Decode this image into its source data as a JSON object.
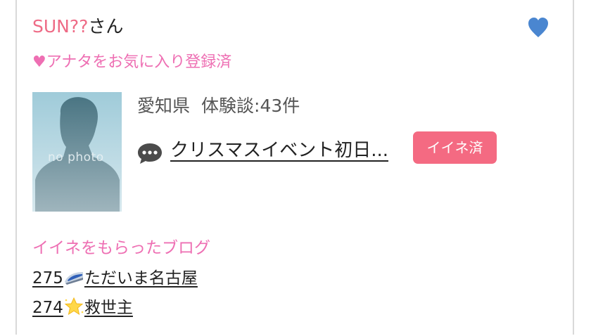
{
  "profile": {
    "name": "SUN??",
    "honorific": "さん",
    "favorite_status": "♥アナタをお気に入り登録済",
    "favorite_icon": "heart-icon",
    "favorite_color": "#4a86d0",
    "avatar_placeholder": "no photo",
    "prefecture": "愛知県",
    "experience_label": "体験談:43件"
  },
  "post": {
    "icon": "speech-bubble-icon",
    "title": "クリスマスイベント初日...",
    "like_label": "イイネ済",
    "like_color": "#f46a82"
  },
  "blogs": {
    "section_title": "イイネをもらったブログ",
    "items": [
      {
        "number": "275",
        "emoji": "train-icon",
        "title": "ただいま名古屋"
      },
      {
        "number": "274",
        "emoji": "star-icon",
        "title": "救世主"
      }
    ]
  },
  "colors": {
    "pink_text": "#ee6b86",
    "magenta_text": "#ee6fb3"
  }
}
